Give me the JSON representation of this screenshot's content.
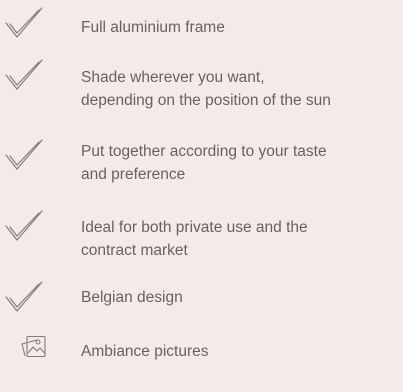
{
  "features": [
    {
      "lines": [
        "Full aluminium frame"
      ],
      "icon": "checkmark-icon"
    },
    {
      "lines": [
        "Shade wherever you want,",
        "depending on the position of the sun"
      ],
      "icon": "checkmark-icon"
    },
    {
      "lines": [
        "Put together according to your taste",
        "and preference"
      ],
      "icon": "checkmark-icon"
    },
    {
      "lines": [
        "Ideal for both private use and the",
        "contract market"
      ],
      "icon": "checkmark-icon"
    },
    {
      "lines": [
        "Belgian design"
      ],
      "icon": "checkmark-icon"
    }
  ],
  "ambiance": {
    "label": "Ambiance pictures",
    "icon": "image-gallery-icon"
  },
  "colors": {
    "background": "#f3ebe7",
    "text": "#6f5f5a",
    "icon_stroke": "#8a7a75"
  }
}
